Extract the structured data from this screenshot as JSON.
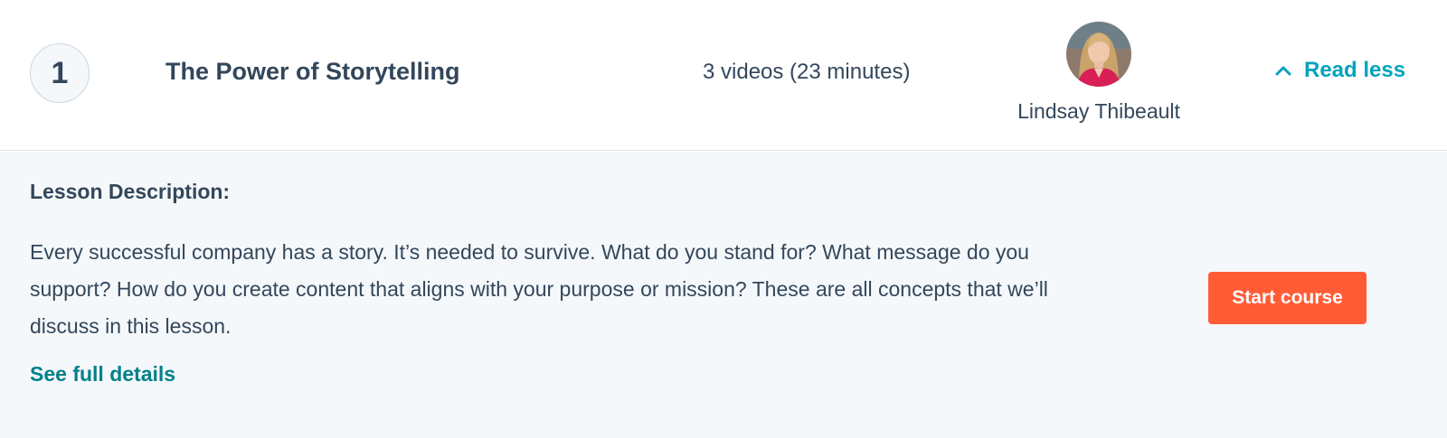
{
  "lesson": {
    "number": "1",
    "title": "The Power of Storytelling",
    "video_summary": "3 videos (23 minutes)",
    "instructor": {
      "name": "Lindsay Thibeault",
      "avatar_icon": "instructor-photo"
    },
    "toggle": {
      "label": "Read less",
      "icon": "chevron-up-icon"
    }
  },
  "details": {
    "heading": "Lesson Description:",
    "description": "Every successful company has a story. It’s needed to survive. What do you stand for? What message do you support? How do you create content that aligns with your purpose or mission? These are all concepts that we’ll discuss in this lesson.",
    "link_label": "See full details",
    "cta_label": "Start course"
  },
  "colors": {
    "text": "#33475b",
    "accent_link": "#00a4bd",
    "details_link": "#00818a",
    "cta": "#ff5c35",
    "body_background": "#f5f8fa",
    "divider": "#dfe3eb"
  }
}
